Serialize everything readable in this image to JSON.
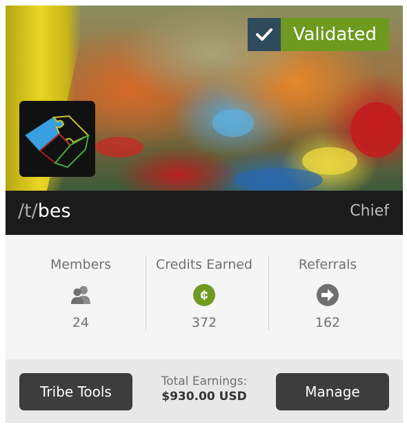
{
  "badge": {
    "label": "Validated",
    "icon": "check-icon"
  },
  "tribe": {
    "prefix": "/t/",
    "name": "bes",
    "role": "Chief",
    "logo": "puzzle-pieces-logo"
  },
  "stats": [
    {
      "title": "Members",
      "icon": "members-icon",
      "value": "24"
    },
    {
      "title": "Credits Earned",
      "icon": "cent-coin-icon",
      "value": "372"
    },
    {
      "title": "Referrals",
      "icon": "arrow-right-circle-icon",
      "value": "162"
    }
  ],
  "footer": {
    "tools_label": "Tribe Tools",
    "earnings_label": "Total Earnings:",
    "earnings_value": "$930.00 USD",
    "manage_label": "Manage"
  },
  "colors": {
    "validated_green": "#6e9a20",
    "credits_green": "#6e9a20",
    "dark_bar": "#1b1b1b",
    "button": "#3d3d3d"
  }
}
